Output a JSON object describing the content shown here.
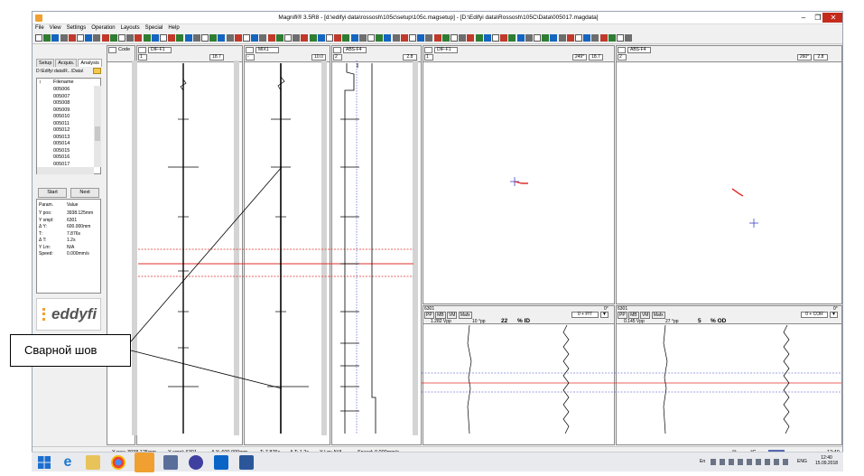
{
  "window": {
    "title": "Magnifi® 3.5R8 - [d:\\edifyi data\\rossosh\\105c\\setup\\105c.magsetup] - [D:\\Edifyi data\\Rossosh\\105C\\Data\\005017.magdata]",
    "min": "–",
    "restore": "❐",
    "close": "✕"
  },
  "menu": [
    "File",
    "View",
    "Settings",
    "Operation",
    "Layouts",
    "Special",
    "Help"
  ],
  "left_panel": {
    "tabs": [
      "Setup",
      "Acquis.",
      "Analysis"
    ],
    "path": "D:\\Edifyi data\\R...\\Data\\",
    "file_header": "Filename",
    "files": [
      "005006",
      "005007",
      "005008",
      "005009",
      "005010",
      "005011",
      "005012",
      "005013",
      "005014",
      "005015",
      "005016",
      "005017"
    ],
    "start": "Start",
    "next": "Next",
    "param_header": "Param.",
    "value_header": "Value",
    "params": [
      {
        "k": "Y pos:",
        "v": "3938.125mm"
      },
      {
        "k": "Y smpl:",
        "v": "6301"
      },
      {
        "k": "Δ Y:",
        "v": "600.000mm"
      },
      {
        "k": "T:",
        "v": "7.876s"
      },
      {
        "k": "Δ T:",
        "v": "1.2s"
      },
      {
        "k": "Y Lm:",
        "v": "N/A"
      },
      {
        "k": "Speed:",
        "v": "0.000mm/s"
      }
    ],
    "logo": "eddyfi"
  },
  "code_panel": {
    "label": "Code"
  },
  "strips": [
    {
      "name": "DIF-F1",
      "num": "1",
      "value": "18.7"
    },
    {
      "name": "MIX1",
      "num": "-",
      "value": "10.0"
    },
    {
      "name": "ABS-F4",
      "num": "2",
      "value": "2.8"
    }
  ],
  "lissajous": [
    {
      "name": "DIF-F1",
      "num": "1",
      "angle": "249°",
      "value": "18.7"
    },
    {
      "name": "ABS-F4",
      "num": "2",
      "angle": "260°",
      "value": "2.8"
    }
  ],
  "measure": [
    {
      "sample": "6301",
      "angle": "0°",
      "tabs": [
        "PP",
        "MB",
        "VM",
        "Mafx"
      ],
      "vpp": "1.282 Vpp",
      "pp": "10 °pp",
      "pct": "22",
      "unit": "% ID",
      "mode": "0 + P/T",
      "flat": "▼"
    },
    {
      "sample": "6301",
      "angle": "0°",
      "tabs": [
        "PP",
        "MB",
        "VM",
        "Mafx"
      ],
      "vpp": "0.145 Vpp",
      "pp": "27 °pp",
      "pct": "5",
      "unit": "% OD",
      "mode": "0 + COR",
      "flat": "▼"
    }
  ],
  "status": {
    "ypos": "Y pos: 3938.125mm",
    "ysmpl": "Y smpl: 6301",
    "dy": "Δ Y: 600.000mm",
    "t": "T: 7.876s",
    "dt": "Δ T: 1.2s",
    "ylm": "Y Lm: N/A",
    "speed": "Speed: 0.000mm/s",
    "pct": "- %",
    "deg": "- °C",
    "time": "12:40"
  },
  "taskbar": {
    "lang": "ENG",
    "time": "12:40",
    "date": "15.09.2018",
    "tray_text": "Еп"
  },
  "callout": "Сварной шов",
  "colors": {
    "red": "#e0302a",
    "blue": "#3a44c8",
    "accent": "#f0a030"
  }
}
